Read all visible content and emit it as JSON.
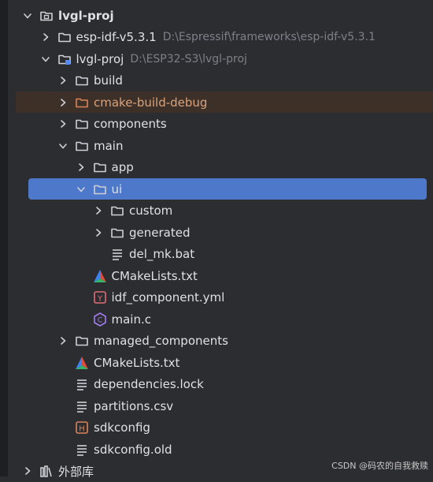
{
  "tree": {
    "items": [
      {
        "label": "lvgl-proj",
        "path": "",
        "indent": 0,
        "arrow": "down",
        "icon": "module",
        "style": "bold",
        "excluded": false,
        "selected": false
      },
      {
        "label": "esp-idf-v5.3.1",
        "path": "D:\\Espressif\\frameworks\\esp-idf-v5.3.1",
        "indent": 1,
        "arrow": "right",
        "icon": "folder",
        "style": "",
        "excluded": false,
        "selected": false
      },
      {
        "label": "lvgl-proj",
        "path": "D:\\ESP32-S3\\lvgl-proj",
        "indent": 1,
        "arrow": "down",
        "icon": "module-folder",
        "style": "",
        "excluded": false,
        "selected": false
      },
      {
        "label": "build",
        "path": "",
        "indent": 2,
        "arrow": "right",
        "icon": "folder",
        "style": "",
        "excluded": false,
        "selected": false
      },
      {
        "label": "cmake-build-debug",
        "path": "",
        "indent": 2,
        "arrow": "right",
        "icon": "folder-excluded",
        "style": "orange",
        "excluded": true,
        "selected": false
      },
      {
        "label": "components",
        "path": "",
        "indent": 2,
        "arrow": "right",
        "icon": "folder",
        "style": "",
        "excluded": false,
        "selected": false
      },
      {
        "label": "main",
        "path": "",
        "indent": 2,
        "arrow": "down",
        "icon": "folder",
        "style": "",
        "excluded": false,
        "selected": false
      },
      {
        "label": "app",
        "path": "",
        "indent": 3,
        "arrow": "right",
        "icon": "folder",
        "style": "",
        "excluded": false,
        "selected": false
      },
      {
        "label": "ui",
        "path": "",
        "indent": 3,
        "arrow": "down",
        "icon": "folder",
        "style": "",
        "excluded": false,
        "selected": true
      },
      {
        "label": "custom",
        "path": "",
        "indent": 4,
        "arrow": "right",
        "icon": "folder",
        "style": "",
        "excluded": false,
        "selected": false
      },
      {
        "label": "generated",
        "path": "",
        "indent": 4,
        "arrow": "right",
        "icon": "folder",
        "style": "",
        "excluded": false,
        "selected": false
      },
      {
        "label": "del_mk.bat",
        "path": "",
        "indent": 4,
        "arrow": "none",
        "icon": "text-file",
        "style": "",
        "excluded": false,
        "selected": false
      },
      {
        "label": "CMakeLists.txt",
        "path": "",
        "indent": 3,
        "arrow": "none",
        "icon": "cmake",
        "style": "",
        "excluded": false,
        "selected": false
      },
      {
        "label": "idf_component.yml",
        "path": "",
        "indent": 3,
        "arrow": "none",
        "icon": "yaml",
        "style": "",
        "excluded": false,
        "selected": false
      },
      {
        "label": "main.c",
        "path": "",
        "indent": 3,
        "arrow": "none",
        "icon": "c-file",
        "style": "",
        "excluded": false,
        "selected": false
      },
      {
        "label": "managed_components",
        "path": "",
        "indent": 2,
        "arrow": "right",
        "icon": "folder",
        "style": "",
        "excluded": false,
        "selected": false
      },
      {
        "label": "CMakeLists.txt",
        "path": "",
        "indent": 2,
        "arrow": "none",
        "icon": "cmake",
        "style": "",
        "excluded": false,
        "selected": false
      },
      {
        "label": "dependencies.lock",
        "path": "",
        "indent": 2,
        "arrow": "none",
        "icon": "text-file",
        "style": "",
        "excluded": false,
        "selected": false
      },
      {
        "label": "partitions.csv",
        "path": "",
        "indent": 2,
        "arrow": "none",
        "icon": "text-file",
        "style": "",
        "excluded": false,
        "selected": false
      },
      {
        "label": "sdkconfig",
        "path": "",
        "indent": 2,
        "arrow": "none",
        "icon": "header-file",
        "style": "",
        "excluded": false,
        "selected": false
      },
      {
        "label": "sdkconfig.old",
        "path": "",
        "indent": 2,
        "arrow": "none",
        "icon": "text-file",
        "style": "",
        "excluded": false,
        "selected": false
      },
      {
        "label": "外部库",
        "path": "",
        "indent": 0,
        "arrow": "right",
        "icon": "library",
        "style": "",
        "excluded": false,
        "selected": false
      }
    ]
  },
  "watermark": {
    "text": "CSDN @码农的自我救赎"
  },
  "colors": {
    "background": "#2b2d30",
    "selection": "#4e78c9",
    "excluded_row": "#3d3028",
    "text": "#dfe1e5",
    "path_text": "#7d8088",
    "excluded_text": "#d9a27a"
  }
}
